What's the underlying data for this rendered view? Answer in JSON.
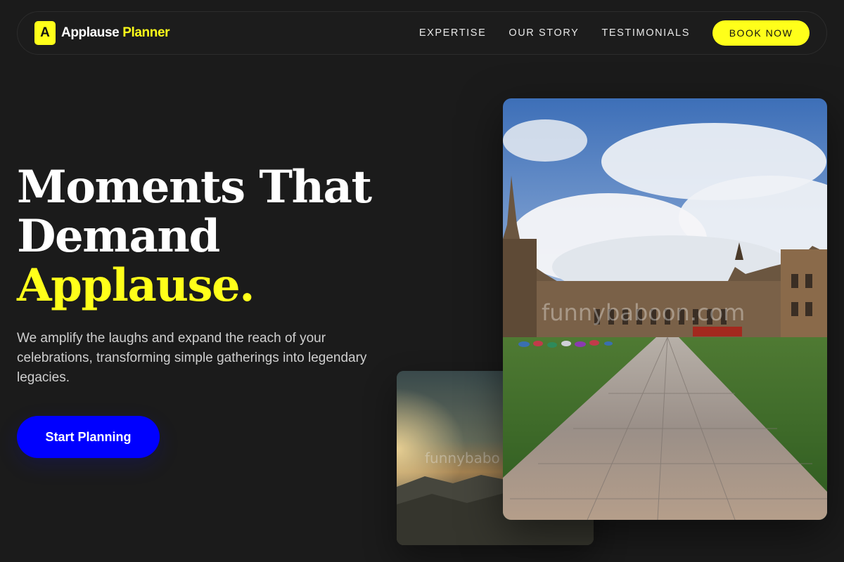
{
  "brand": {
    "logo_letter": "A",
    "name_part1": "Applause",
    "name_part2": "Planner"
  },
  "nav": {
    "links": [
      "EXPERTISE",
      "OUR STORY",
      "TESTIMONIALS"
    ],
    "book_label": "BOOK NOW"
  },
  "hero": {
    "headline_line1": "Moments That",
    "headline_line2": "Demand",
    "headline_highlight": "Applause.",
    "subtext": "We amplify the laughs and expand the reach of your celebrations, transforming simple gatherings into legendary legacies.",
    "cta_label": "Start Planning"
  },
  "images": {
    "front_watermark": "funnybaboon.com",
    "back_watermark": "funnybabo"
  },
  "colors": {
    "accent_yellow": "#ffff1a",
    "cta_blue": "#0000ff",
    "background": "#1b1b1b"
  }
}
